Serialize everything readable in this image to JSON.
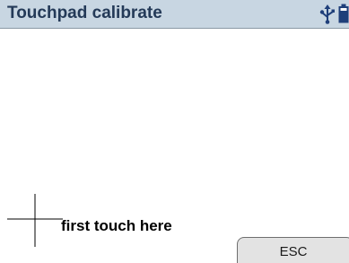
{
  "titlebar": {
    "title": "Touchpad calibrate",
    "background_color": "#c8d6e2",
    "title_color": "#243a58",
    "icons": [
      "usb-icon",
      "battery-icon"
    ]
  },
  "main": {
    "instruction": "first touch here",
    "target_marker": "crosshair-icon"
  },
  "footer": {
    "esc_label": "ESC"
  }
}
